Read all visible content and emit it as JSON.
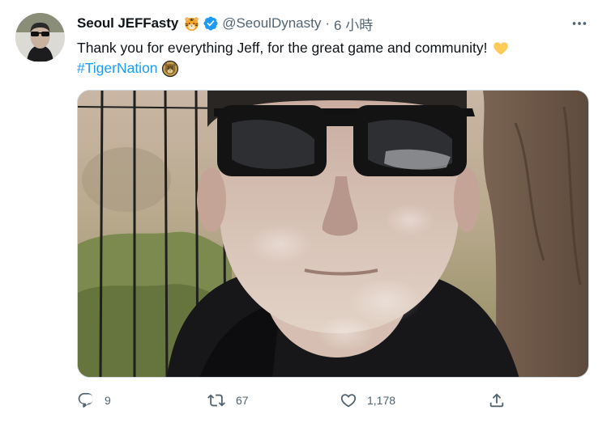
{
  "author": {
    "display_name": "Seoul JEFFasty",
    "handle": "@SeoulDynasty",
    "separator": "·",
    "time": "6 小時"
  },
  "tweet": {
    "text": "Thank you for everything Jeff, for the great game and community!",
    "hashtag": "#TigerNation"
  },
  "actions": {
    "reply_count": "9",
    "retweet_count": "67",
    "like_count": "1,178"
  },
  "icons": {
    "display_name_emoji": "tiger-face-icon",
    "verified": "verified-badge-icon",
    "more": "more-horizontal-icon",
    "text_emoji": "yellow-heart-icon",
    "hashtag_badge": "tiger-nation-badge-icon",
    "reply": "reply-icon",
    "retweet": "retweet-icon",
    "like": "like-icon",
    "share": "share-icon"
  },
  "colors": {
    "accent": "#1d9bf0",
    "text_primary": "#0f1419",
    "text_secondary": "#536471",
    "border": "#cfd9de"
  }
}
